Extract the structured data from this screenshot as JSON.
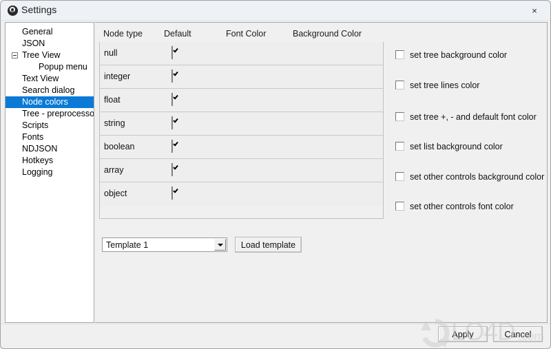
{
  "window": {
    "title": "Settings",
    "icon": "app-circle-icon",
    "close_label": "×"
  },
  "sidebar": {
    "items": [
      {
        "label": "General",
        "level": 0,
        "expander": false,
        "selected": false
      },
      {
        "label": "JSON",
        "level": 0,
        "expander": false,
        "selected": false
      },
      {
        "label": "Tree View",
        "level": 0,
        "expander": true,
        "selected": false
      },
      {
        "label": "Popup menu",
        "level": 1,
        "expander": false,
        "selected": false
      },
      {
        "label": "Text View",
        "level": 0,
        "expander": false,
        "selected": false
      },
      {
        "label": "Search dialog",
        "level": 0,
        "expander": false,
        "selected": false
      },
      {
        "label": "Node colors",
        "level": 0,
        "expander": false,
        "selected": true
      },
      {
        "label": "Tree - preprocessor",
        "level": 0,
        "expander": false,
        "selected": false
      },
      {
        "label": "Scripts",
        "level": 0,
        "expander": false,
        "selected": false
      },
      {
        "label": "Fonts",
        "level": 0,
        "expander": false,
        "selected": false
      },
      {
        "label": "NDJSON",
        "level": 0,
        "expander": false,
        "selected": false
      },
      {
        "label": "Hotkeys",
        "level": 0,
        "expander": false,
        "selected": false
      },
      {
        "label": "Logging",
        "level": 0,
        "expander": false,
        "selected": false
      }
    ],
    "selected_index": 6,
    "selection_color": "#0a7ad6"
  },
  "grid": {
    "columns": [
      "Node type",
      "Default",
      "Font Color",
      "Background Color"
    ],
    "rows": [
      {
        "node_type": "null",
        "default_checked": true,
        "font_color": "",
        "background_color": ""
      },
      {
        "node_type": "integer",
        "default_checked": true,
        "font_color": "",
        "background_color": ""
      },
      {
        "node_type": "float",
        "default_checked": true,
        "font_color": "",
        "background_color": ""
      },
      {
        "node_type": "string",
        "default_checked": true,
        "font_color": "",
        "background_color": ""
      },
      {
        "node_type": "boolean",
        "default_checked": true,
        "font_color": "",
        "background_color": ""
      },
      {
        "node_type": "array",
        "default_checked": true,
        "font_color": "",
        "background_color": ""
      },
      {
        "node_type": "object",
        "default_checked": true,
        "font_color": "",
        "background_color": ""
      }
    ]
  },
  "template": {
    "selected": "Template 1",
    "load_button": "Load template"
  },
  "options": [
    {
      "label": "set tree background color",
      "checked": false
    },
    {
      "label": "set tree lines color",
      "checked": false
    },
    {
      "label": "set tree +, - and default font color",
      "checked": false
    },
    {
      "label": "set list background color",
      "checked": false
    },
    {
      "label": "set other controls background color",
      "checked": false
    },
    {
      "label": "set other controls font color",
      "checked": false
    }
  ],
  "footer": {
    "apply_label": "Apply",
    "cancel_label": "Cancel"
  },
  "watermark": {
    "text": "LO4D",
    "suffix": ".com"
  }
}
